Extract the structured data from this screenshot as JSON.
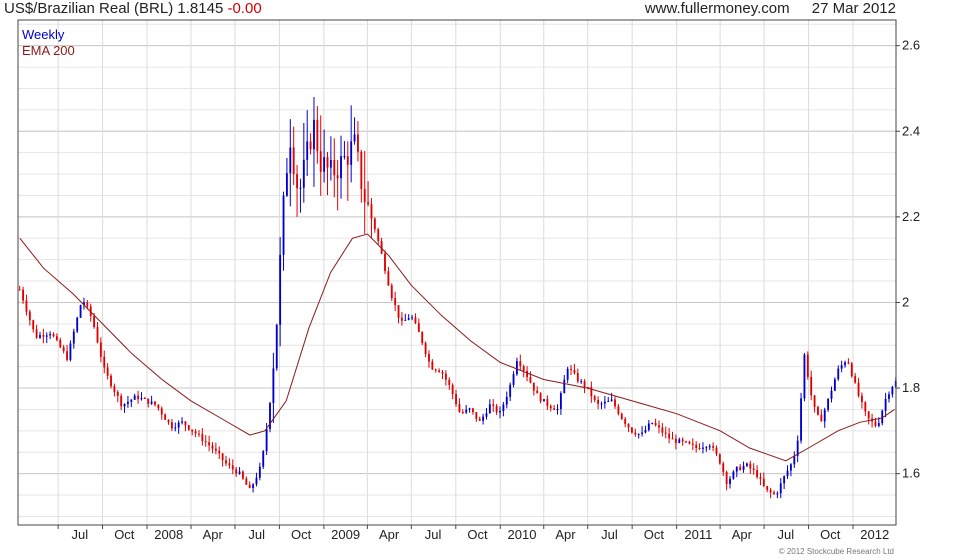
{
  "header": {
    "instrument": "US$/Brazilian Real (BRL)",
    "last": "1.8145",
    "change": "-0.00",
    "site": "www.fullermoney.com",
    "date": "27 Mar 2012"
  },
  "legend": {
    "period": "Weekly",
    "ema": "EMA 200"
  },
  "footer": {
    "credit": "© 2012 Stockcube Research Ltd"
  },
  "colors": {
    "up": "#0000cc",
    "down": "#e00000",
    "ema": "#8b1a1a",
    "grid": "#c8c8c8",
    "legend_period": "#0000cc",
    "legend_ema": "#8b1a1a"
  },
  "chart_data": {
    "type": "candlestick",
    "yticks": [
      "1.6",
      "1.8",
      "2",
      "2.2",
      "2.4",
      "2.6"
    ],
    "ylim": [
      1.48,
      2.66
    ],
    "x_labels": [
      "Jul",
      "Oct",
      "2008",
      "Apr",
      "Jul",
      "Oct",
      "2009",
      "Apr",
      "Jul",
      "Oct",
      "2010",
      "Apr",
      "Jul",
      "Oct",
      "2011",
      "Apr",
      "Jul",
      "Oct",
      "2012"
    ],
    "x_dates": [
      "2007-07-01",
      "2007-10-01",
      "2008-01-01",
      "2008-04-01",
      "2008-07-01",
      "2008-10-01",
      "2009-01-01",
      "2009-04-01",
      "2009-07-01",
      "2009-10-01",
      "2010-01-01",
      "2010-04-01",
      "2010-07-01",
      "2010-10-01",
      "2011-01-01",
      "2011-04-01",
      "2011-07-01",
      "2011-10-01",
      "2012-01-01"
    ],
    "x_range": [
      "2007-04-09",
      "2012-03-30"
    ],
    "grid": true,
    "legend_position": "top-left",
    "series_close": [
      [
        "2007-04-13",
        2.03
      ],
      [
        "2007-05-15",
        1.92
      ],
      [
        "2007-06-15",
        1.93
      ],
      [
        "2007-07-20",
        1.87
      ],
      [
        "2007-08-20",
        2.01
      ],
      [
        "2007-09-10",
        1.96
      ],
      [
        "2007-10-05",
        1.84
      ],
      [
        "2007-11-10",
        1.76
      ],
      [
        "2007-12-10",
        1.78
      ],
      [
        "2008-01-20",
        1.76
      ],
      [
        "2008-02-20",
        1.71
      ],
      [
        "2008-03-15",
        1.72
      ],
      [
        "2008-04-15",
        1.69
      ],
      [
        "2008-05-15",
        1.66
      ],
      [
        "2008-06-15",
        1.62
      ],
      [
        "2008-07-10",
        1.6
      ],
      [
        "2008-08-01",
        1.56
      ],
      [
        "2008-08-25",
        1.62
      ],
      [
        "2008-09-10",
        1.75
      ],
      [
        "2008-09-25",
        1.95
      ],
      [
        "2008-10-08",
        2.2
      ],
      [
        "2008-10-22",
        2.4
      ],
      [
        "2008-11-10",
        2.25
      ],
      [
        "2008-11-25",
        2.33
      ],
      [
        "2008-12-10",
        2.42
      ],
      [
        "2008-12-25",
        2.33
      ],
      [
        "2009-01-15",
        2.3
      ],
      [
        "2009-02-10",
        2.33
      ],
      [
        "2009-03-05",
        2.37
      ],
      [
        "2009-03-25",
        2.25
      ],
      [
        "2009-04-15",
        2.18
      ],
      [
        "2009-05-01",
        2.11
      ],
      [
        "2009-05-20",
        2.02
      ],
      [
        "2009-06-10",
        1.95
      ],
      [
        "2009-06-30",
        1.97
      ],
      [
        "2009-07-20",
        1.92
      ],
      [
        "2009-08-10",
        1.85
      ],
      [
        "2009-09-01",
        1.84
      ],
      [
        "2009-09-20",
        1.8
      ],
      [
        "2009-10-10",
        1.74
      ],
      [
        "2009-10-30",
        1.75
      ],
      [
        "2009-11-20",
        1.72
      ],
      [
        "2009-12-10",
        1.76
      ],
      [
        "2009-12-31",
        1.74
      ],
      [
        "2010-01-20",
        1.8
      ],
      [
        "2010-02-05",
        1.87
      ],
      [
        "2010-02-25",
        1.83
      ],
      [
        "2010-03-20",
        1.78
      ],
      [
        "2010-04-10",
        1.76
      ],
      [
        "2010-04-30",
        1.75
      ],
      [
        "2010-05-20",
        1.85
      ],
      [
        "2010-06-10",
        1.82
      ],
      [
        "2010-06-30",
        1.8
      ],
      [
        "2010-07-20",
        1.76
      ],
      [
        "2010-08-20",
        1.77
      ],
      [
        "2010-09-10",
        1.73
      ],
      [
        "2010-09-30",
        1.7
      ],
      [
        "2010-10-20",
        1.69
      ],
      [
        "2010-11-10",
        1.72
      ],
      [
        "2010-11-30",
        1.7
      ],
      [
        "2010-12-20",
        1.68
      ],
      [
        "2011-01-20",
        1.67
      ],
      [
        "2011-02-10",
        1.66
      ],
      [
        "2011-03-10",
        1.67
      ],
      [
        "2011-03-31",
        1.63
      ],
      [
        "2011-04-15",
        1.58
      ],
      [
        "2011-05-05",
        1.61
      ],
      [
        "2011-05-25",
        1.62
      ],
      [
        "2011-06-15",
        1.6
      ],
      [
        "2011-07-05",
        1.56
      ],
      [
        "2011-07-25",
        1.55
      ],
      [
        "2011-08-15",
        1.6
      ],
      [
        "2011-08-30",
        1.63
      ],
      [
        "2011-09-10",
        1.69
      ],
      [
        "2011-09-22",
        1.88
      ],
      [
        "2011-10-10",
        1.76
      ],
      [
        "2011-10-25",
        1.72
      ],
      [
        "2011-11-10",
        1.77
      ],
      [
        "2011-11-30",
        1.84
      ],
      [
        "2011-12-20",
        1.87
      ],
      [
        "2012-01-10",
        1.79
      ],
      [
        "2012-01-30",
        1.73
      ],
      [
        "2012-02-20",
        1.71
      ],
      [
        "2012-03-10",
        1.78
      ],
      [
        "2012-03-27",
        1.815
      ]
    ],
    "ema_200": [
      [
        "2007-04-13",
        2.15
      ],
      [
        "2007-06-01",
        2.08
      ],
      [
        "2007-08-01",
        2.02
      ],
      [
        "2007-10-01",
        1.95
      ],
      [
        "2007-12-01",
        1.88
      ],
      [
        "2008-02-01",
        1.82
      ],
      [
        "2008-04-01",
        1.77
      ],
      [
        "2008-06-01",
        1.73
      ],
      [
        "2008-08-01",
        1.69
      ],
      [
        "2008-09-01",
        1.7
      ],
      [
        "2008-10-15",
        1.77
      ],
      [
        "2008-12-01",
        1.94
      ],
      [
        "2009-01-15",
        2.07
      ],
      [
        "2009-03-01",
        2.15
      ],
      [
        "2009-04-01",
        2.16
      ],
      [
        "2009-05-15",
        2.11
      ],
      [
        "2009-07-01",
        2.04
      ],
      [
        "2009-09-01",
        1.97
      ],
      [
        "2009-11-01",
        1.91
      ],
      [
        "2010-01-01",
        1.86
      ],
      [
        "2010-04-01",
        1.82
      ],
      [
        "2010-07-01",
        1.8
      ],
      [
        "2010-10-01",
        1.77
      ],
      [
        "2011-01-01",
        1.74
      ],
      [
        "2011-04-01",
        1.7
      ],
      [
        "2011-06-01",
        1.66
      ],
      [
        "2011-08-15",
        1.63
      ],
      [
        "2011-10-01",
        1.66
      ],
      [
        "2011-12-01",
        1.7
      ],
      [
        "2012-01-15",
        1.72
      ],
      [
        "2012-03-01",
        1.73
      ],
      [
        "2012-03-27",
        1.75
      ]
    ]
  }
}
